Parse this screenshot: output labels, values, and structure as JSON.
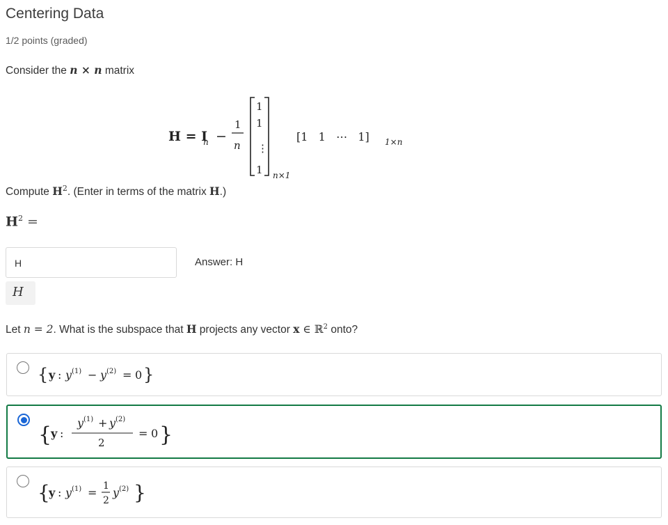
{
  "problem": {
    "title": "Centering Data",
    "points": "1/2 points (graded)",
    "intro": {
      "prefix": "Consider the ",
      "var": "n × n",
      "suffix": " matrix"
    },
    "equation": {
      "lhs": "H = I",
      "lhs_sub": "n",
      "frac_num": "1",
      "frac_den": "n",
      "column_entries": [
        "1",
        "1",
        "⋮",
        "1"
      ],
      "column_sub": "n×1",
      "row_text": "[1   1   ⋯   1]",
      "row_sub": "1×n"
    },
    "compute_prompt": {
      "prefix": "Compute ",
      "expr": "H",
      "sup": "2",
      "suffix": ". (Enter in terms of the matrix ",
      "var": "H",
      "end": ".)"
    },
    "answer_label": {
      "lhs": "H",
      "sup": "2",
      "eq": " ="
    },
    "input_value": "H",
    "answer_text": "Answer: H",
    "preview_text": "H",
    "question2": {
      "prefix": "Let ",
      "n_eq": "n = 2",
      "mid": ". What is the subspace that ",
      "H": "H",
      "mid2": " projects any vector ",
      "x": "x",
      "in": " ∈ ",
      "R": "ℝ",
      "R_sup": "2",
      "suffix": " onto?"
    },
    "options": [
      {
        "selected": false
      },
      {
        "selected": true
      },
      {
        "selected": false
      }
    ]
  },
  "colors": {
    "selected_border": "#137a45",
    "radio_selected": "#1a66d6",
    "default_border": "#d9d9d9"
  }
}
